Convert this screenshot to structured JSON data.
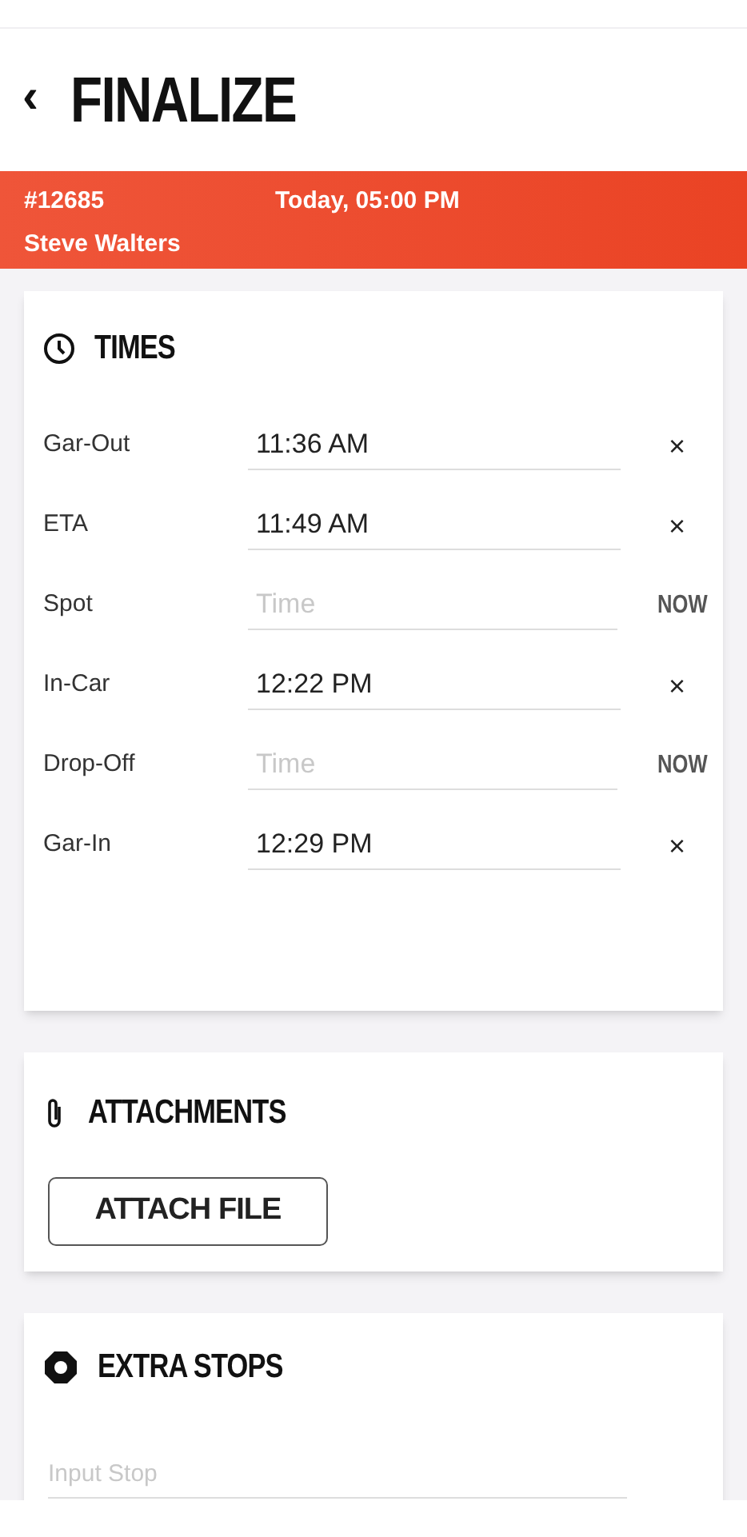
{
  "header": {
    "back": "‹",
    "title": "FINALIZE"
  },
  "job": {
    "number": "#12685",
    "time": "Today, 05:00 PM",
    "customer": "Steve Walters"
  },
  "times": {
    "title": "TIMES",
    "rows": [
      {
        "kind": "filled",
        "label": "Gar-Out",
        "value": "11:36 AM",
        "action": "×"
      },
      {
        "kind": "filled",
        "label": "ETA",
        "value": "11:49 AM",
        "action": "×"
      },
      {
        "kind": "empty",
        "label": "Spot",
        "placeholder": "Time",
        "action": "NOW"
      },
      {
        "kind": "filled",
        "label": "In-Car",
        "value": "12:22 PM",
        "action": "×"
      },
      {
        "kind": "empty",
        "label": "Drop-Off",
        "placeholder": "Time",
        "action": "NOW"
      },
      {
        "kind": "filled",
        "label": "Gar-In",
        "value": "12:29 PM",
        "action": "×"
      }
    ]
  },
  "attachments": {
    "title": "ATTACHMENTS",
    "button": "ATTACH FILE"
  },
  "extra_stops": {
    "title": "EXTRA STOPS",
    "placeholder": "Input Stop"
  }
}
